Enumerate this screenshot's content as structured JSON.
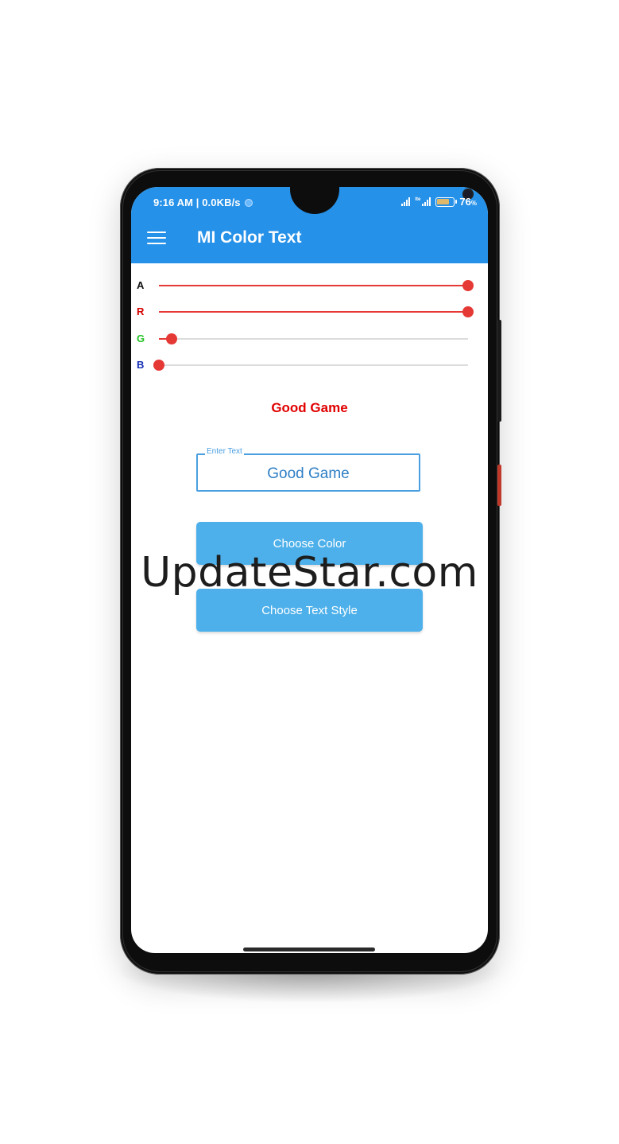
{
  "status_bar": {
    "time": "9:16 AM | 0.0KB/s",
    "battery": "76",
    "battery_unit": "%",
    "battery_level": 0.76
  },
  "app_bar": {
    "title": "MI Color Text"
  },
  "sliders": [
    {
      "label": "A",
      "label_color": "#111111",
      "value": 1.0
    },
    {
      "label": "R",
      "label_color": "#d40000",
      "value": 1.0
    },
    {
      "label": "G",
      "label_color": "#22c322",
      "value": 0.04
    },
    {
      "label": "B",
      "label_color": "#1530b8",
      "value": 0.0
    }
  ],
  "preview": {
    "text": "Good Game",
    "color": "#e00000"
  },
  "input": {
    "label": "Enter Text",
    "value": "Good Game"
  },
  "buttons": {
    "choose_color": "Choose Color",
    "choose_text_style": "Choose Text Style"
  },
  "watermark": "UpdateStar.com",
  "colors": {
    "app_bar": "#2691e8",
    "slider_accent": "#e53935",
    "button": "#4db0ea"
  }
}
